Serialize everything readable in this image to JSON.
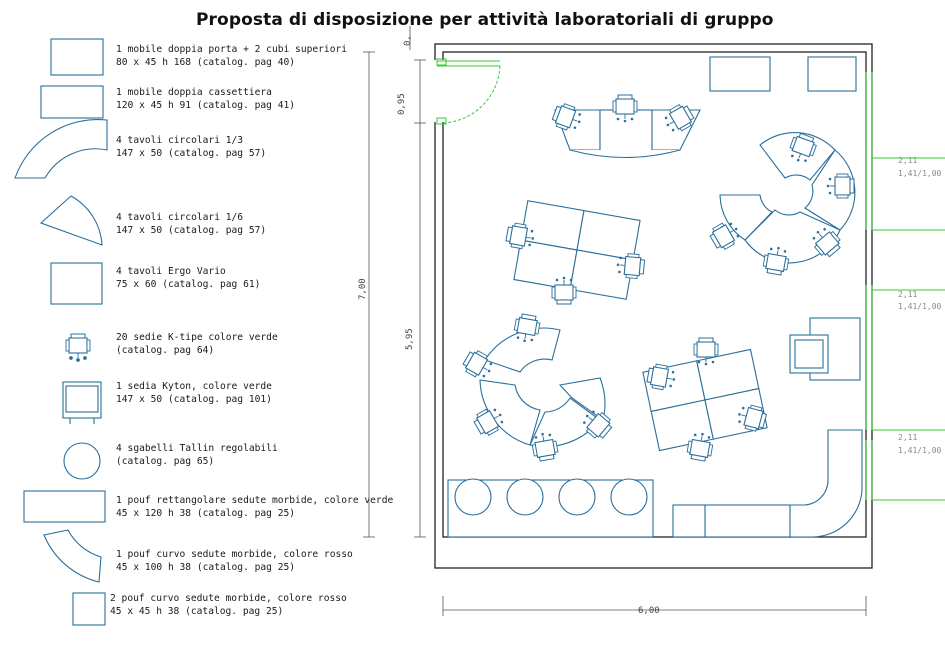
{
  "title": "Proposta di disposizione per attività laboratoriali di gruppo",
  "legend": [
    {
      "line1": "1 mobile doppia porta + 2 cubi superiori",
      "line2": "80 x 45 h 168 (catalog. pag 40)"
    },
    {
      "line1": "1 mobile doppia cassettiera",
      "line2": "120 x 45 h 91 (catalog. pag 41)"
    },
    {
      "line1": "4 tavoli circolari 1/3",
      "line2": "147 x 50 (catalog. pag 57)"
    },
    {
      "line1": "4 tavoli circolari 1/6",
      "line2": "147 x 50 (catalog. pag 57)"
    },
    {
      "line1": "4 tavoli Ergo Vario",
      "line2": "75 x 60 (catalog. pag 61)"
    },
    {
      "line1": "20 sedie K-tipe colore verde",
      "line2": "(catalog. pag 64)"
    },
    {
      "line1": "1 sedia Kyton, colore verde",
      "line2": "147 x 50 (catalog. pag 101)"
    },
    {
      "line1": "4 sgabelli Tallin regolabili",
      "line2": "(catalog. pag 65)"
    },
    {
      "line1": "1 pouf rettangolare sedute morbide, colore verde",
      "line2": "45 x 120 h 38 (catalog. pag 25)"
    },
    {
      "line1": "1 pouf curvo sedute morbide, colore rosso",
      "line2": "45 x 100 h 38 (catalog. pag 25)"
    },
    {
      "line1": "2 pouf curvo sedute morbide, colore rosso",
      "line2": "45 x 45 h 38 (catalog. pag 25)"
    }
  ],
  "dimensions": {
    "total_height": "7,00",
    "inner_height": "5,95",
    "door_width": "0,95",
    "top_gap": "0,",
    "room_width": "6,00",
    "windows": [
      "2,11",
      "1,41/1,00"
    ]
  },
  "colors": {
    "furniture": "#2a6f9b",
    "walls": "#222222",
    "windows": "#33cc33",
    "title": "#111111"
  }
}
